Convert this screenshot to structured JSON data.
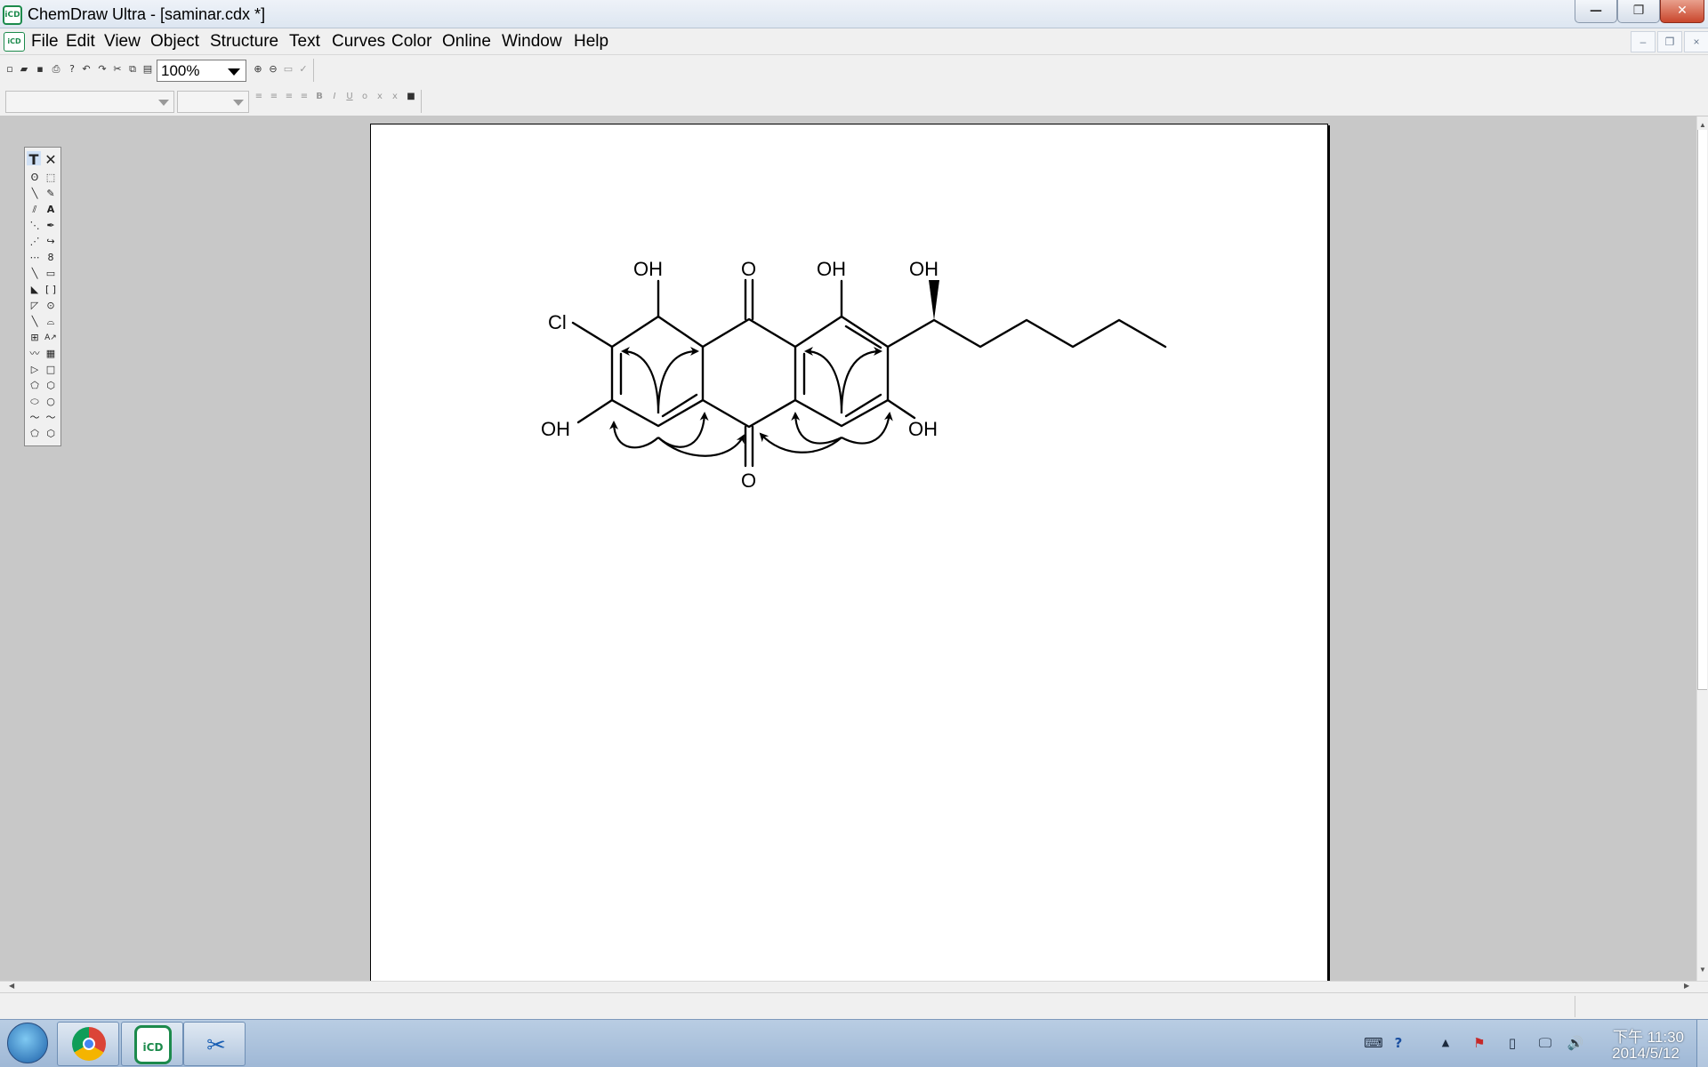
{
  "window": {
    "app_icon": "chemdraw-icon",
    "app_icon_text": "iCD",
    "title": "ChemDraw Ultra - [saminar.cdx *]",
    "minimize": "—",
    "maximize": "❐",
    "close": "✕"
  },
  "menu": {
    "doc_icon": "iCD",
    "items": [
      "File",
      "Edit",
      "View",
      "Object",
      "Structure",
      "Text",
      "Curves",
      "Color",
      "Online",
      "Window",
      "Help"
    ],
    "mdi_minimize": "–",
    "mdi_restore": "❐",
    "mdi_close": "×"
  },
  "toolbar": {
    "zoom": "100%"
  },
  "palette": {
    "text_tool": "T",
    "eraser_tool": "✕"
  },
  "structure": {
    "labels": {
      "cl": "Cl",
      "oh_top_left": "OH",
      "o_top": "O",
      "oh_top_mid": "OH",
      "oh_side_chain": "OH",
      "oh_bottom_left": "OH",
      "oh_bottom_right": "OH",
      "o_bottom": "O"
    }
  },
  "taskbar": {
    "chemdraw_label": "iCD",
    "clock_time": "下午 11:30",
    "clock_date": "2014/5/12"
  }
}
